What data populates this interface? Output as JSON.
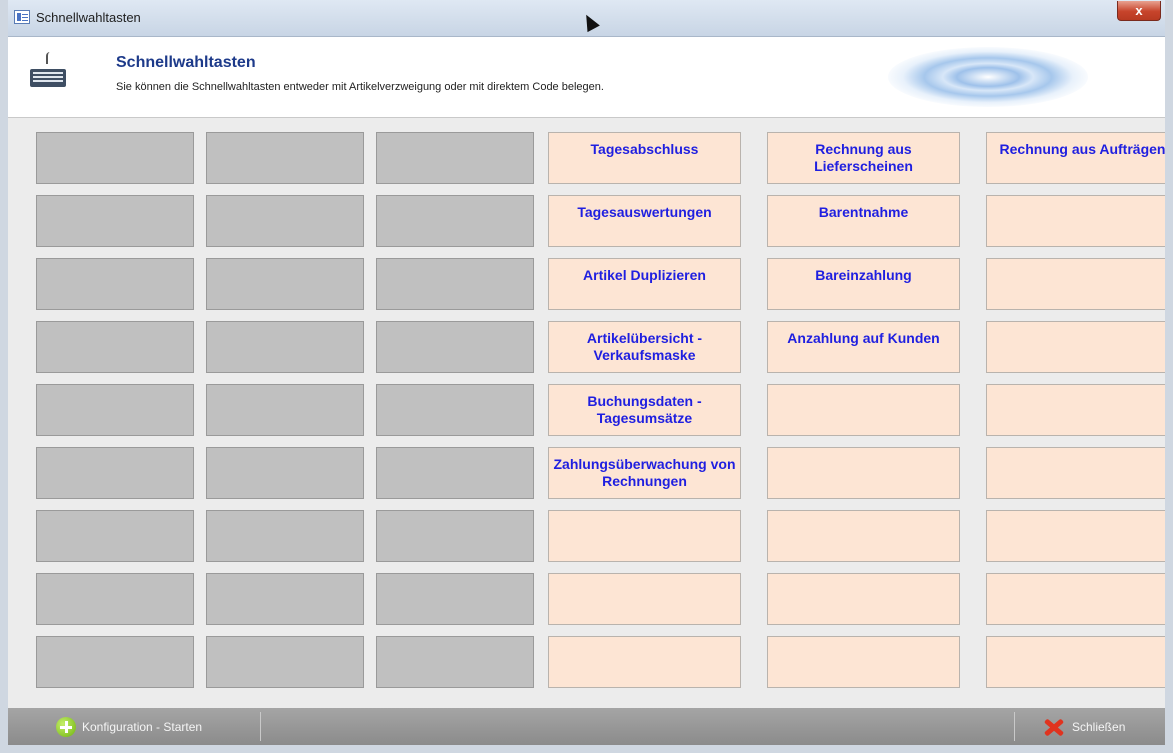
{
  "window": {
    "title": "Schnellwahltasten",
    "close_glyph": "x"
  },
  "header": {
    "title": "Schnellwahltasten",
    "subtitle": "Sie können die Schnellwahltasten entweder mit Artikelverzweigung oder mit direktem Code belegen."
  },
  "grid": {
    "columns": 6,
    "rows": 9,
    "colors": {
      "empty": "#c0c0c0",
      "assigned": "#fde5d4",
      "label": "#1f1fe0"
    },
    "buttons": [
      [
        "",
        "",
        "",
        "Tagesabschluss",
        "Rechnung aus Lieferscheinen",
        "Rechnung aus Aufträgen"
      ],
      [
        "",
        "",
        "",
        "Tagesauswertungen",
        "Barentnahme",
        ""
      ],
      [
        "",
        "",
        "",
        "Artikel Duplizieren",
        "Bareinzahlung",
        ""
      ],
      [
        "",
        "",
        "",
        "Artikelübersicht - Verkaufsmaske",
        "Anzahlung auf Kunden",
        ""
      ],
      [
        "",
        "",
        "",
        "Buchungsdaten - Tagesumsätze",
        "",
        ""
      ],
      [
        "",
        "",
        "",
        "Zahlungsüberwachung von Rechnungen",
        "",
        ""
      ],
      [
        "",
        "",
        "",
        "",
        "",
        ""
      ],
      [
        "",
        "",
        "",
        "",
        "",
        ""
      ],
      [
        "",
        "",
        "",
        "",
        "",
        ""
      ]
    ]
  },
  "footer": {
    "config_label": "Konfiguration - Starten",
    "close_label": "Schließen"
  }
}
